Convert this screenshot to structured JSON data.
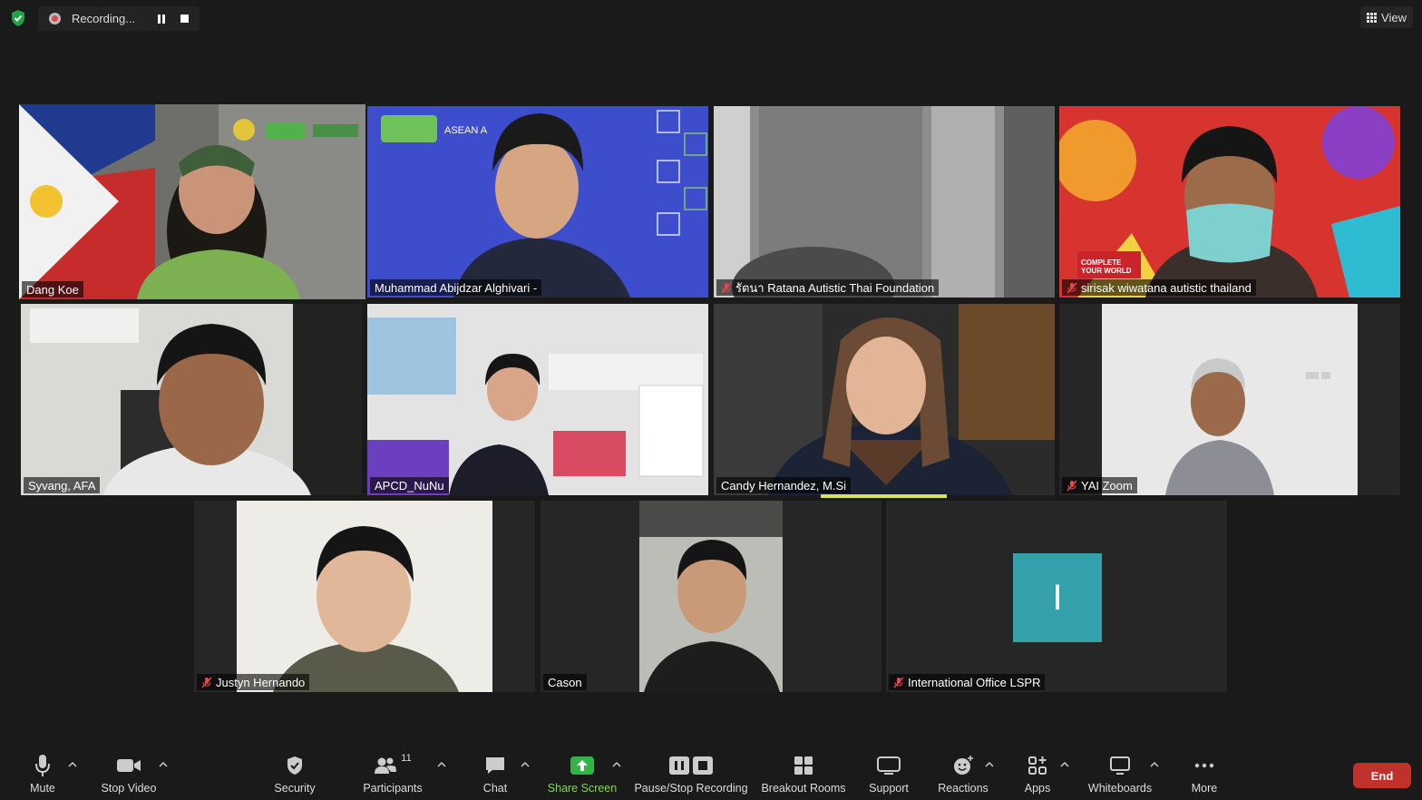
{
  "recording": {
    "status": "Recording..."
  },
  "view": {
    "label": "View"
  },
  "participants": [
    {
      "name": "Dang Koe",
      "muted": false,
      "active_speaker": true
    },
    {
      "name": "Muhammad Abijdzar Alghivari -",
      "muted": false
    },
    {
      "name": "รัตนา Ratana Autistic Thai Foundation",
      "muted": true
    },
    {
      "name": "sirisak wiwatana autistic thailand",
      "muted": true
    },
    {
      "name": "Syvang, AFA",
      "muted": false
    },
    {
      "name": "APCD_NuNu",
      "muted": false
    },
    {
      "name": "Candy Hernandez, M.Si",
      "muted": false
    },
    {
      "name": "YAI Zoom",
      "muted": true
    },
    {
      "name": "Justyn Hernando",
      "muted": true
    },
    {
      "name": "Cason",
      "muted": false
    },
    {
      "name": "International Office LSPR",
      "muted": true,
      "avatar_letter": "I"
    }
  ],
  "toolbar": {
    "mute": "Mute",
    "stop_video": "Stop Video",
    "security": "Security",
    "participants": "Participants",
    "participants_count": "11",
    "chat": "Chat",
    "share_screen": "Share Screen",
    "pause_stop_recording": "Pause/Stop Recording",
    "breakout_rooms": "Breakout Rooms",
    "support": "Support",
    "reactions": "Reactions",
    "apps": "Apps",
    "whiteboards": "Whiteboards",
    "more": "More",
    "end": "End"
  },
  "colors": {
    "active_speaker": "#d7e35a",
    "share_green": "#7ed957",
    "end_red": "#c0312b",
    "avatar_teal": "#35a1ad"
  }
}
